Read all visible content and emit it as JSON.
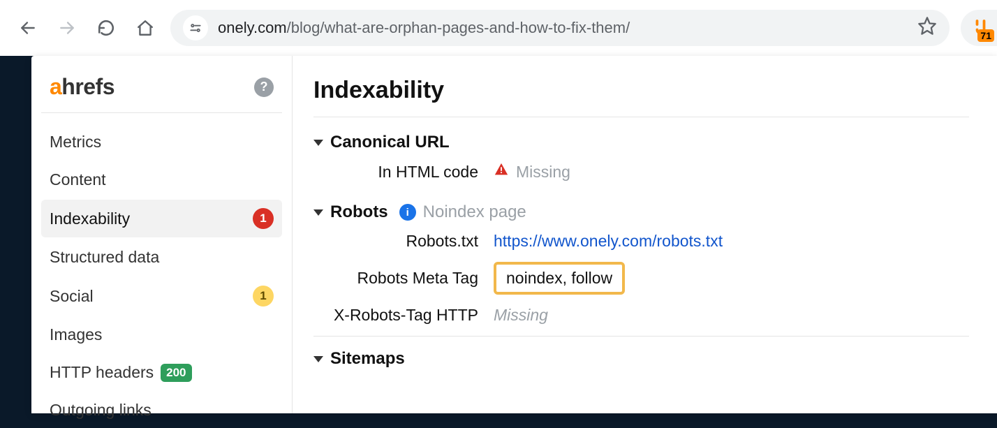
{
  "browser": {
    "url_host": "onely.com",
    "url_path": "/blog/what-are-orphan-pages-and-how-to-fix-them/",
    "extension_badge": "71"
  },
  "sidebar": {
    "logo_a": "a",
    "logo_rest": "hrefs",
    "items": [
      {
        "label": "Metrics"
      },
      {
        "label": "Content"
      },
      {
        "label": "Indexability",
        "badge": "1",
        "badge_color": "red",
        "active": true
      },
      {
        "label": "Structured data"
      },
      {
        "label": "Social",
        "badge": "1",
        "badge_color": "yellow"
      },
      {
        "label": "Images"
      },
      {
        "label": "HTTP headers",
        "badge": "200",
        "badge_color": "green"
      },
      {
        "label": "Outgoing links"
      }
    ]
  },
  "main": {
    "title": "Indexability",
    "sections": {
      "canonical": {
        "heading": "Canonical URL",
        "rows": [
          {
            "label": "In HTML code",
            "status": "Missing",
            "warn": true
          }
        ]
      },
      "robots": {
        "heading": "Robots",
        "hint": "Noindex page",
        "rows": [
          {
            "label": "Robots.txt",
            "link": "https://www.onely.com/robots.txt"
          },
          {
            "label": "Robots Meta Tag",
            "value": "noindex, follow",
            "highlight": true
          },
          {
            "label": "X-Robots-Tag HTTP",
            "status": "Missing",
            "italic": true
          }
        ]
      },
      "sitemaps": {
        "heading": "Sitemaps"
      }
    }
  }
}
